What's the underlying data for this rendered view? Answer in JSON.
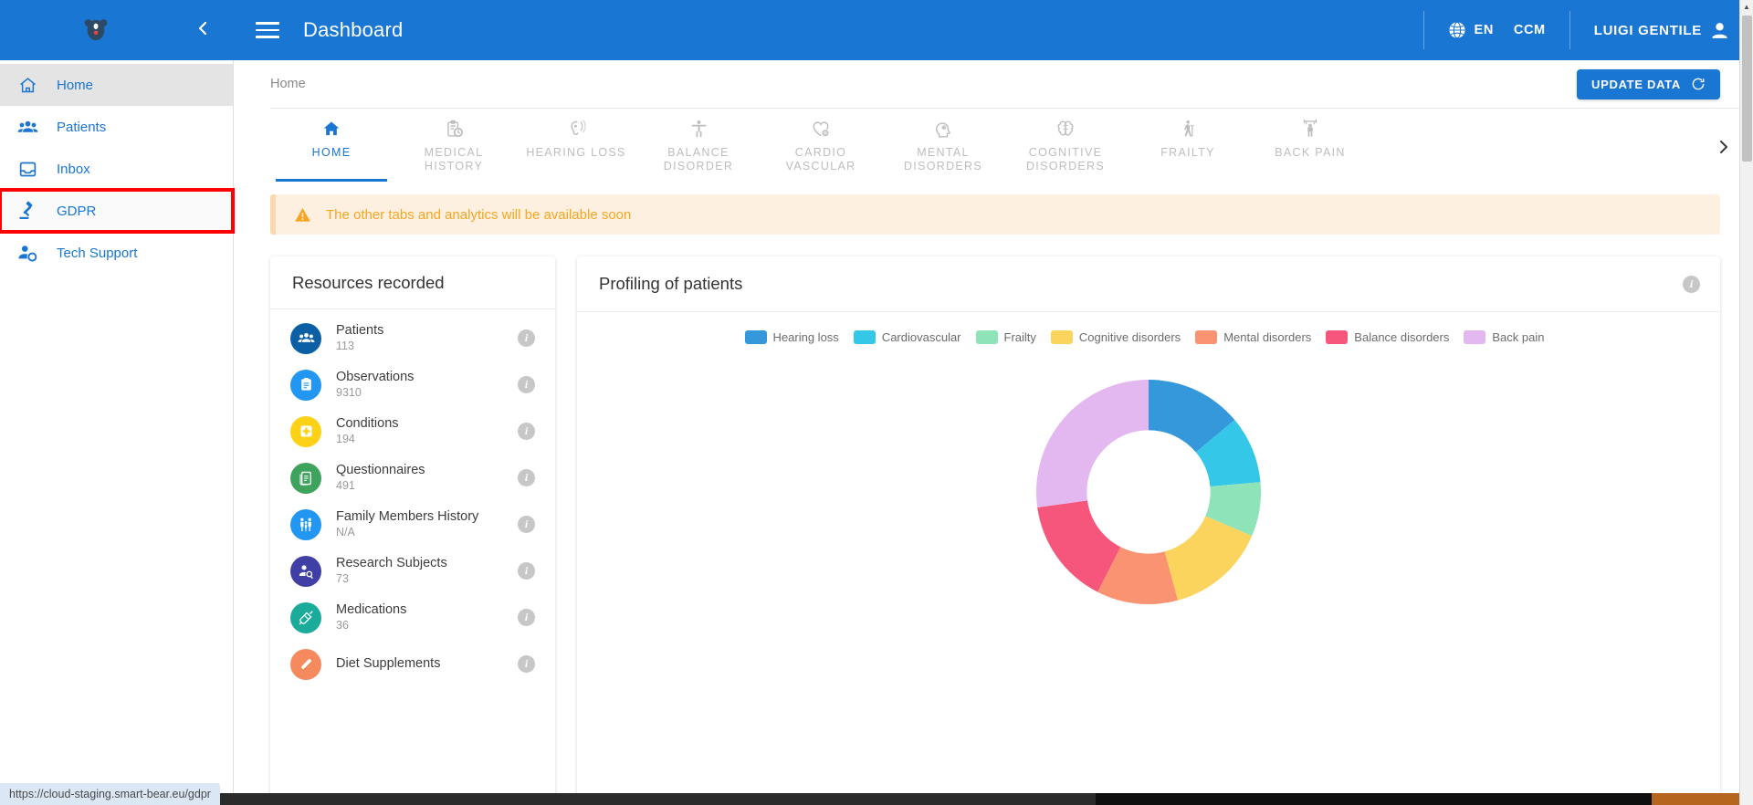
{
  "header": {
    "title": "Dashboard",
    "menu_icon": "hamburger-icon",
    "collapse_icon": "chevron-left-icon",
    "logo": "smart-bear-logo",
    "language": "EN",
    "project": "CCM",
    "user": "LUIGI GENTILE",
    "globe_icon": "globe-icon",
    "avatar_icon": "person-icon",
    "bg_color": "#1976d2"
  },
  "sidebar": {
    "items": [
      {
        "label": "Home",
        "icon": "home-icon",
        "active": true,
        "highlight": false
      },
      {
        "label": "Patients",
        "icon": "people-icon",
        "active": false,
        "highlight": false
      },
      {
        "label": "Inbox",
        "icon": "inbox-icon",
        "active": false,
        "highlight": false
      },
      {
        "label": "GDPR",
        "icon": "gavel-icon",
        "active": false,
        "highlight": true
      },
      {
        "label": "Tech Support",
        "icon": "person-gear-icon",
        "active": false,
        "highlight": false
      }
    ]
  },
  "breadcrumb": {
    "text": "Home"
  },
  "toolbar": {
    "update_label": "UPDATE DATA",
    "update_icon": "refresh-icon",
    "accent": "#1976d2"
  },
  "tabs": {
    "next_icon": "chevron-right-icon",
    "items": [
      {
        "label": "HOME",
        "icon": "home-icon",
        "active": true
      },
      {
        "label": "MEDICAL\nHISTORY",
        "icon": "clipboard-clock-icon",
        "active": false
      },
      {
        "label": "HEARING LOSS",
        "icon": "ear-icon",
        "active": false
      },
      {
        "label": "BALANCE\nDISORDER",
        "icon": "accessibility-icon",
        "active": false
      },
      {
        "label": "CARDIO\nVASCULAR",
        "icon": "heart-gear-icon",
        "active": false
      },
      {
        "label": "MENTAL\nDISORDERS",
        "icon": "head-star-icon",
        "active": false
      },
      {
        "label": "COGNITIVE\nDISORDERS",
        "icon": "brain-icon",
        "active": false
      },
      {
        "label": "FRAILTY",
        "icon": "elderly-icon",
        "active": false
      },
      {
        "label": "BACK PAIN",
        "icon": "weightlifting-icon",
        "active": false
      }
    ]
  },
  "warning": {
    "icon": "warning-triangle-icon",
    "text": "The other tabs and analytics will be available soon",
    "text_color": "#f5a623",
    "bg_color": "#fdf0e1"
  },
  "resources": {
    "title": "Resources recorded",
    "info_icon": "info-icon",
    "items": [
      {
        "name": "Patients",
        "value": "113",
        "color": "#0b5fa5",
        "icon": "people-icon"
      },
      {
        "name": "Observations",
        "value": "9310",
        "color": "#2196f3",
        "icon": "clipboard-icon"
      },
      {
        "name": "Conditions",
        "value": "194",
        "color": "#fdd116",
        "icon": "medical-cross-icon"
      },
      {
        "name": "Questionnaires",
        "value": "491",
        "color": "#3da35d",
        "icon": "questionnaire-icon"
      },
      {
        "name": "Family Members History",
        "value": "N/A",
        "color": "#2196f3",
        "icon": "family-icon"
      },
      {
        "name": "Research Subjects",
        "value": "73",
        "color": "#3f3fa5",
        "icon": "person-search-icon"
      },
      {
        "name": "Medications",
        "value": "36",
        "color": "#1aab9b",
        "icon": "syringe-icon"
      },
      {
        "name": "Diet Supplements",
        "value": "",
        "color": "#f58a5e",
        "icon": "supplement-icon"
      }
    ]
  },
  "profiling": {
    "title": "Profiling of patients",
    "info_icon": "info-icon"
  },
  "chart_data": {
    "type": "pie",
    "title": "Profiling of patients",
    "variant": "donut",
    "legend_position": "top",
    "categories": [
      "Hearing loss",
      "Cardiovascular",
      "Frailty",
      "Cognitive disorders",
      "Mental disorders",
      "Balance disorders",
      "Back pain"
    ],
    "colors": [
      "#3498db",
      "#35c7e8",
      "#8fe3b8",
      "#fbd45e",
      "#fa9372",
      "#f7567c",
      "#e3b8f0"
    ],
    "values": [
      13.9,
      9.7,
      7.8,
      14.4,
      11.7,
      15.3,
      27.2
    ],
    "unit": "%",
    "start_angle_deg": 0,
    "direction": "clockwise",
    "inner_radius_ratio": 0.55
  },
  "statusbar": {
    "url": "https://cloud-staging.smart-bear.eu/gdpr"
  }
}
